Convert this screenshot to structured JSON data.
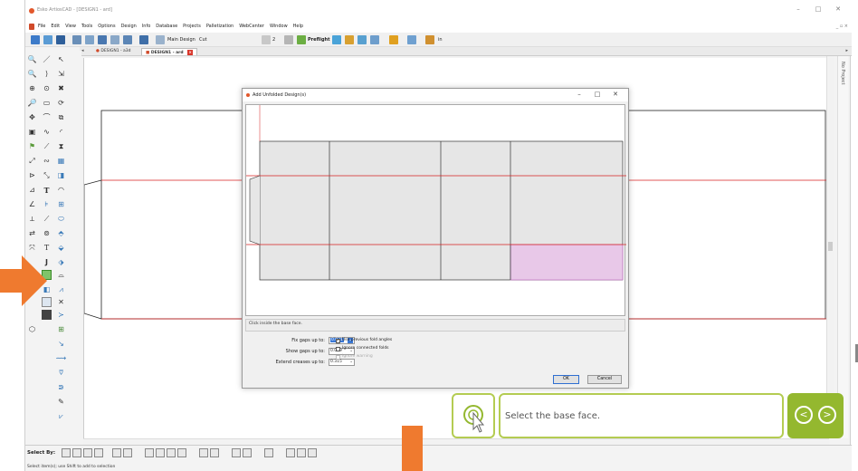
{
  "window": {
    "title": "Esko ArtiosCAD - [DESIGN1 - ard]",
    "controls": [
      "–",
      "□",
      "✕"
    ],
    "restore": "_ ▫ ×"
  },
  "menu": {
    "items": [
      "File",
      "Edit",
      "View",
      "Tools",
      "Options",
      "Design",
      "Info",
      "Database",
      "Projects",
      "Palletization",
      "WebCenter",
      "Window",
      "Help"
    ]
  },
  "toolbar": {
    "main_design_label": "Main Design",
    "cut_label": "Cut",
    "layer_num": "2",
    "preflight_label": "Preflight",
    "inch_label": "in"
  },
  "tabs": [
    {
      "label": "DESIGN1 - a3d"
    },
    {
      "label": "DESIGN1 - ard"
    }
  ],
  "sidepanel": {
    "label": "No Project"
  },
  "dialog": {
    "title": "Add Unfolded Design(s)",
    "status_text": "Click inside the base face.",
    "fix_gaps_label": "Fix gaps up to:",
    "fix_gaps_value": "0.031",
    "show_gaps_label": "Show gaps up to:",
    "show_gaps_value": "0.039",
    "extend_creases_label": "Extend creases up to:",
    "extend_creases_value": "0.315",
    "use_previous_label": "Use previous fold angles",
    "use_previous_checked": true,
    "ignore_connected_label": "Ignore connected folds",
    "ignore_connected_checked": false,
    "ignore_warning_label": "Ignore warning",
    "ok_label": "OK",
    "cancel_label": "Cancel"
  },
  "statusbar": {
    "select_by": "Select By:",
    "hint": "Select item(s); use Shift to add to selection"
  },
  "guide": {
    "instruction": "Select the base face.",
    "prev_icon": "chevron-left-icon",
    "next_icon": "chevron-right-icon"
  },
  "colors": {
    "accent_orange": "#ef7a2f",
    "guide_green": "#94b82f",
    "guide_border": "#b4cc52",
    "selected_face": "#e8c8e8",
    "fold_line": "#d62020"
  }
}
